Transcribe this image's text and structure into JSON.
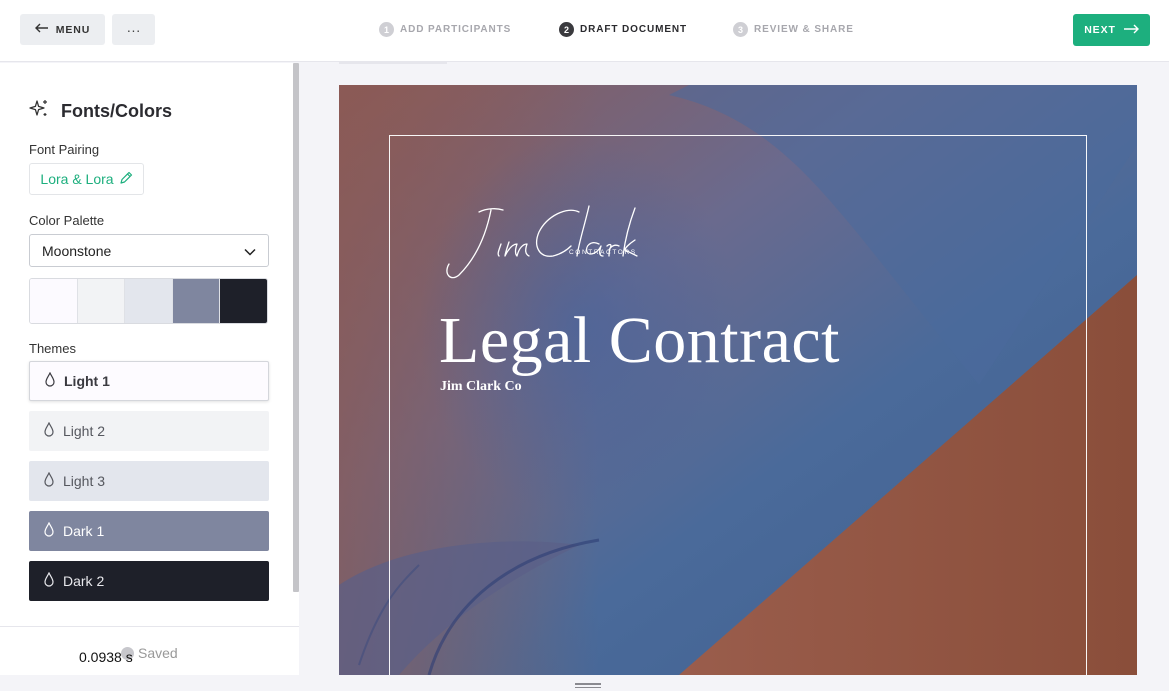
{
  "topbar": {
    "menu_label": "MENU",
    "more_label": "···",
    "next_label": "NEXT",
    "steps": [
      {
        "num": "1",
        "label": "ADD PARTICIPANTS"
      },
      {
        "num": "2",
        "label": "DRAFT DOCUMENT"
      },
      {
        "num": "3",
        "label": "REVIEW & SHARE"
      }
    ],
    "active_step": 2
  },
  "sidebar": {
    "title": "Fonts/Colors",
    "font_pairing": {
      "label": "Font Pairing",
      "value": "Lora & Lora"
    },
    "color_palette": {
      "label": "Color Palette",
      "selected": "Moonstone",
      "swatches": [
        "#fcfaff",
        "#f2f3f5",
        "#e3e6ed",
        "#7f869f",
        "#1e2029"
      ]
    },
    "themes": {
      "label": "Themes",
      "items": [
        {
          "label": "Light 1",
          "bg": "#fdfbff",
          "fg": "#3a3a40",
          "selected": true
        },
        {
          "label": "Light 2",
          "bg": "#f2f3f5",
          "fg": "#55575e",
          "selected": false
        },
        {
          "label": "Light 3",
          "bg": "#e3e6ed",
          "fg": "#55575e",
          "selected": false
        },
        {
          "label": "Dark 1",
          "bg": "#7f869f",
          "fg": "#ffffff",
          "selected": false
        },
        {
          "label": "Dark 2",
          "bg": "#1e2029",
          "fg": "#e8e8ec",
          "selected": false
        }
      ]
    },
    "footer": {
      "timing": "0.0938 s",
      "status": "Saved"
    }
  },
  "document": {
    "logo_script": "Jim Clark",
    "logo_caption": "CONTRACTORS",
    "title": "Legal Contract",
    "subtitle": "Jim Clark Co"
  },
  "colors": {
    "accent": "#1daf7e"
  }
}
